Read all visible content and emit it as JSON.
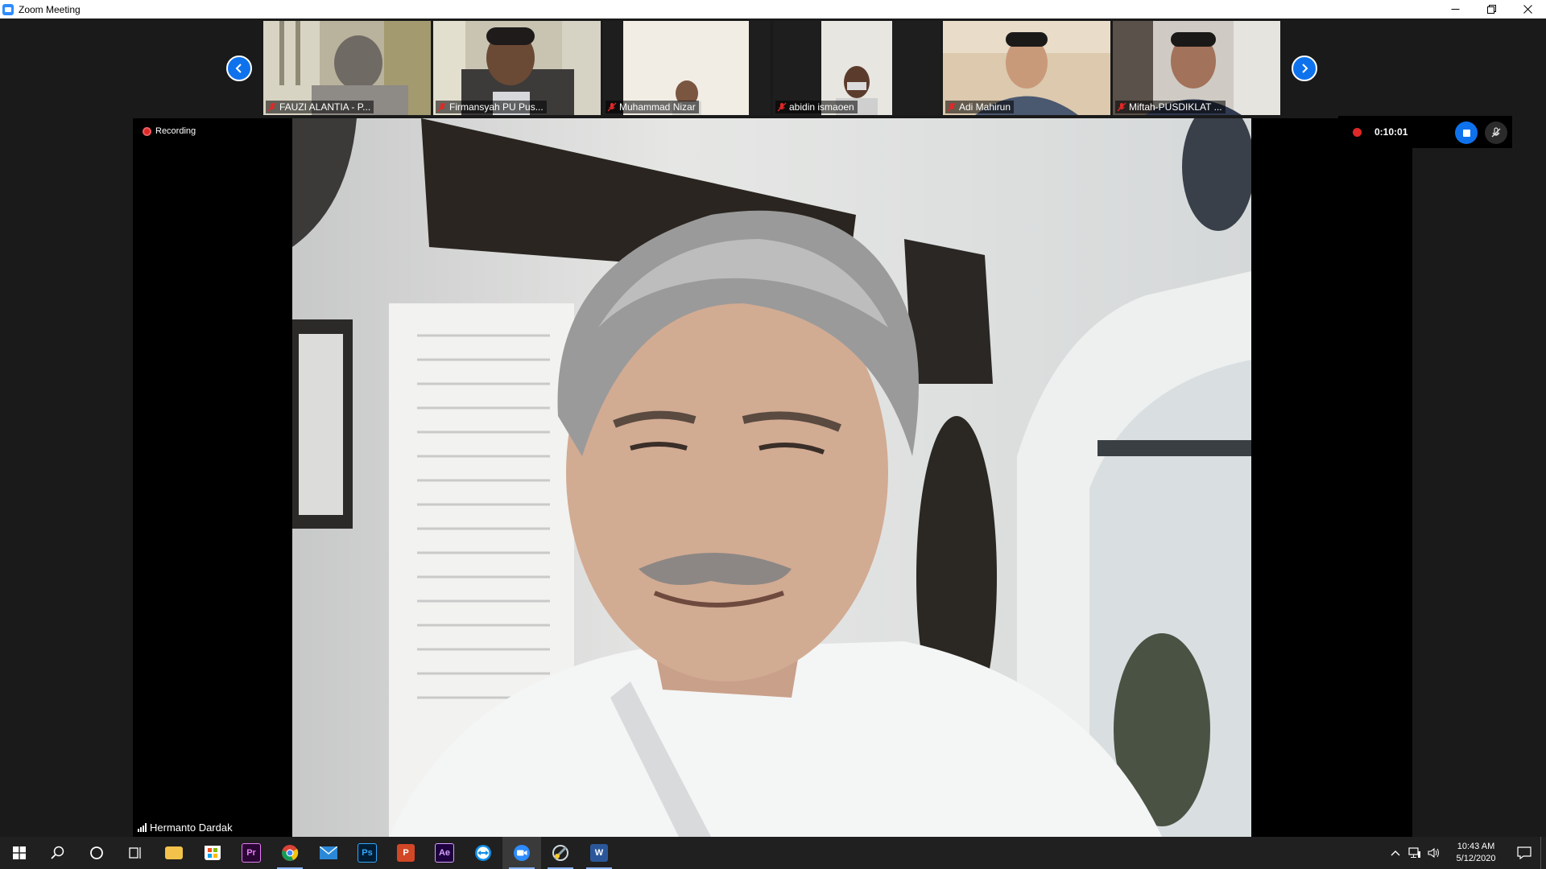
{
  "window": {
    "title": "Zoom Meeting"
  },
  "participants": [
    {
      "name": "FAUZI ALANTIA - P..."
    },
    {
      "name": "Firmansyah PU Pus..."
    },
    {
      "name": "Muhammad Nizar"
    },
    {
      "name": "abidin ismaoen"
    },
    {
      "name": "Adi Mahirun"
    },
    {
      "name": "Miftah-PUSDIKLAT ..."
    }
  ],
  "main": {
    "recording_label": "Recording",
    "speaker_name": "Hermanto Dardak"
  },
  "recording": {
    "elapsed": "0:10:01"
  },
  "taskbar": {
    "apps": [
      {
        "label": ""
      },
      {
        "label": ""
      },
      {
        "label": ""
      },
      {
        "label": ""
      },
      {
        "label": "Pr"
      },
      {
        "label": ""
      },
      {
        "label": ""
      },
      {
        "label": "Ps"
      },
      {
        "label": "P"
      },
      {
        "label": "Ae"
      },
      {
        "label": ""
      },
      {
        "label": ""
      },
      {
        "label": ""
      },
      {
        "label": "W"
      }
    ],
    "clock": {
      "time": "10:43 AM",
      "date": "5/12/2020"
    }
  },
  "colors": {
    "zoom_blue": "#0e72ed",
    "recording_red": "#e02828",
    "taskbar": "#202020",
    "background": "#1a1a1a"
  }
}
